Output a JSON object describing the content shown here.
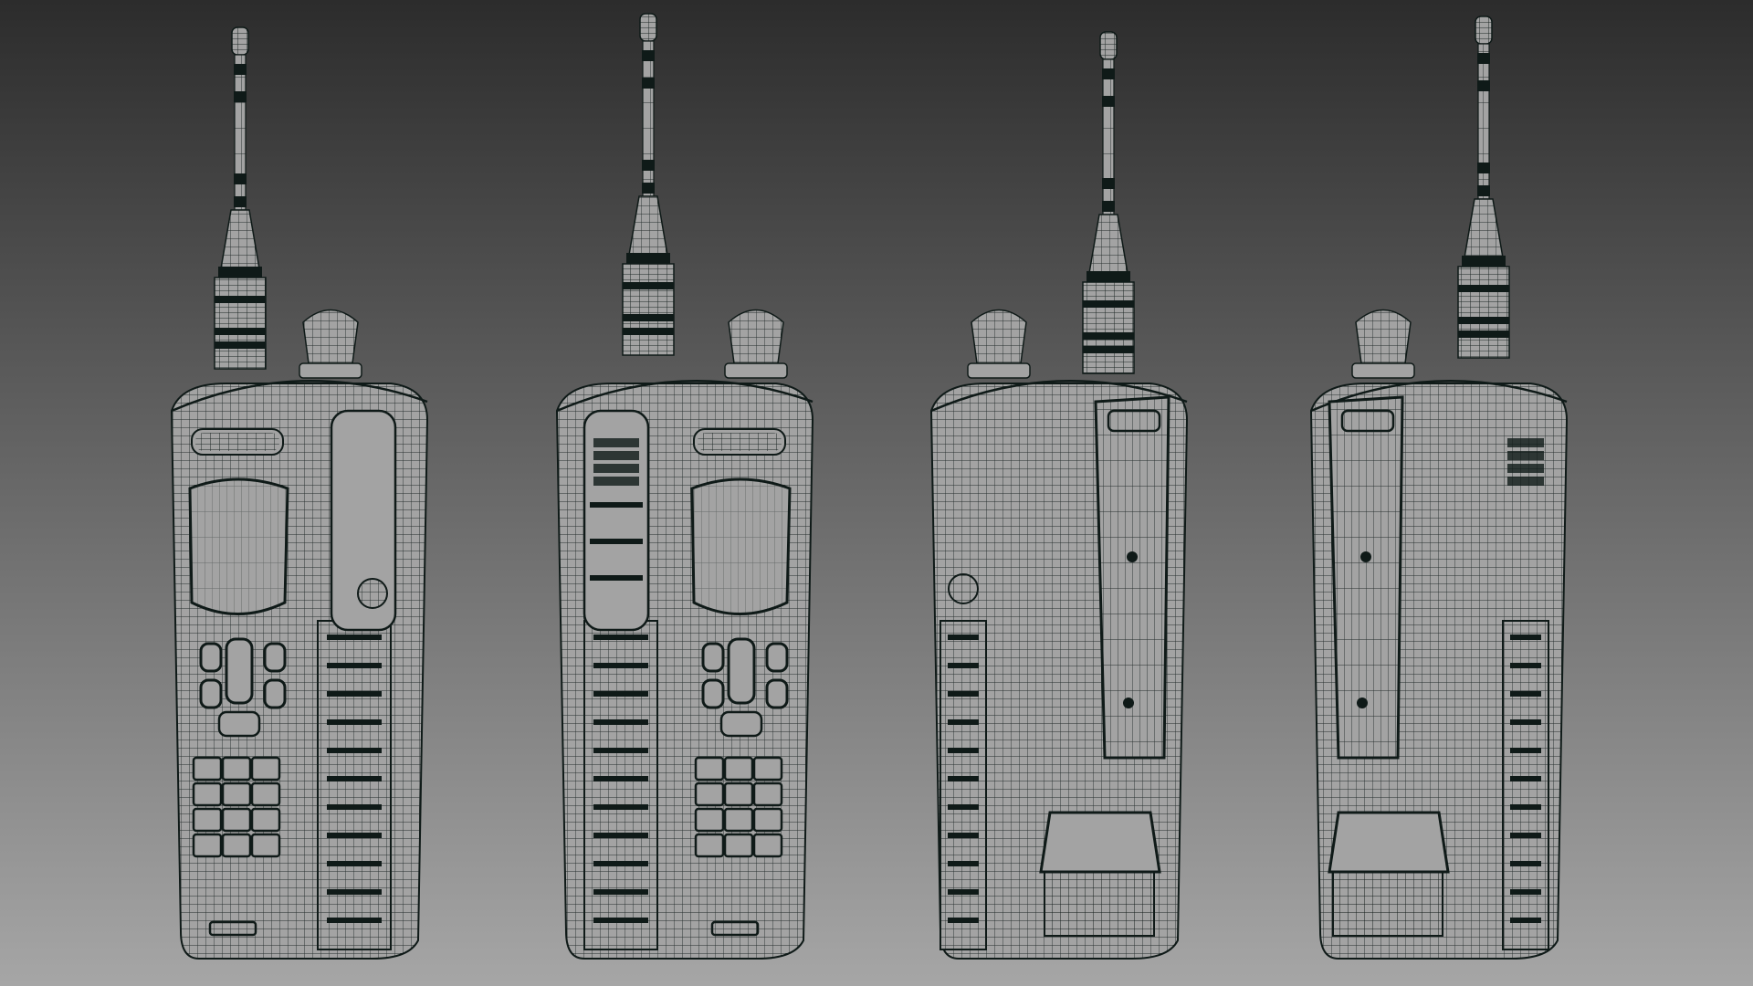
{
  "viewport": {
    "background_top": "#2c2c2c",
    "background_bottom": "#a6a6a6"
  },
  "render": {
    "style": "wireframe-on-shaded",
    "surface_color": "#a3a3a3",
    "wire_color": "#0f1a18",
    "highlight_color": "#1a2a26"
  },
  "models": [
    {
      "id": "radio-front-left",
      "view": "front-three-quarter-left"
    },
    {
      "id": "radio-front-right",
      "view": "front-three-quarter-right"
    },
    {
      "id": "radio-back-left",
      "view": "back-three-quarter-left"
    },
    {
      "id": "radio-back-right",
      "view": "back-three-quarter-right"
    }
  ]
}
